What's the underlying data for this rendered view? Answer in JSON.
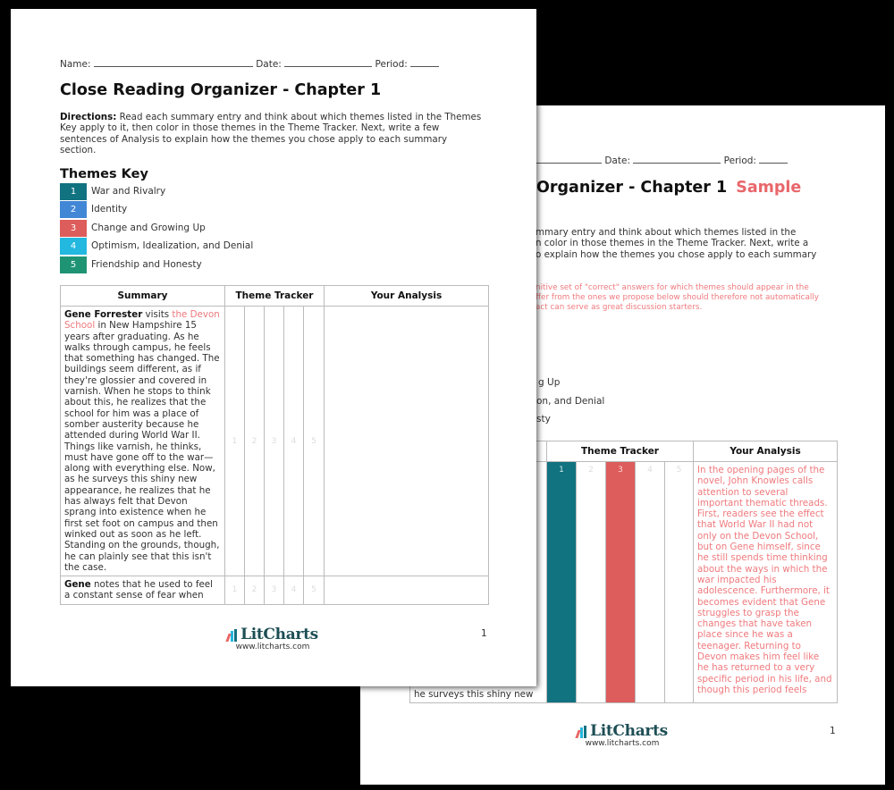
{
  "colors": {
    "theme1": "#117280",
    "theme2": "#4287d6",
    "theme3": "#dd5c5c",
    "theme4": "#22b8e0",
    "theme5": "#1f9475",
    "accent_red": "#ef7a7e",
    "logo_dark": "#1d4e55"
  },
  "front": {
    "fields": {
      "name": "Name:",
      "date": "Date:",
      "period": "Period:"
    },
    "title": "Close Reading Organizer - Chapter 1",
    "directions_label": "Directions:",
    "directions_text": " Read each summary entry and think about which themes listed in the Themes Key apply to it, then color in those themes in the Theme Tracker. Next, write a few sentences of Analysis to explain how the themes you chose apply to each summary section.",
    "themes_heading": "Themes Key",
    "themes": [
      {
        "num": "1",
        "label": "War and Rivalry"
      },
      {
        "num": "2",
        "label": "Identity"
      },
      {
        "num": "3",
        "label": "Change and Growing Up"
      },
      {
        "num": "4",
        "label": "Optimism, Idealization, and Denial"
      },
      {
        "num": "5",
        "label": "Friendship and Honesty"
      }
    ],
    "table": {
      "headers": {
        "summary": "Summary",
        "tracker": "Theme Tracker",
        "analysis": "Your Analysis"
      },
      "rows": [
        {
          "bold": "Gene Forrester",
          "pre": " visits ",
          "link": "the Devon School",
          "rest": " in New Hampshire 15 years after graduating. As he walks through campus, he feels that something has changed. The buildings seem different, as if they're glossier and covered in varnish. When he stops to think about this, he realizes that the school for him was a place of somber austerity because he attended during World War II. Things like varnish, he thinks, must have gone off to the war—along with everything else. Now, as he surveys this shiny new appearance, he realizes that he has always felt that Devon sprang into existence when he first set foot on campus and then winked out as soon as he left. Standing on the grounds, though, he can plainly see that this isn't the case.",
          "tracker": [
            "1",
            "2",
            "3",
            "4",
            "5"
          ],
          "analysis": ""
        },
        {
          "bold": "Gene",
          "pre": " notes that he used to feel a constant sense of fear when",
          "link": "",
          "rest": "",
          "tracker": [
            "1",
            "2",
            "3",
            "4",
            "5"
          ],
          "analysis": ""
        }
      ]
    },
    "logo": {
      "name": "LitCharts",
      "url": "www.litcharts.com"
    },
    "page_number": "1"
  },
  "back": {
    "fields_visible": {
      "date": "Date:",
      "period": "Period:"
    },
    "title_visible": "Organizer - Chapter 1",
    "sample_label": "Sample",
    "directions_visible": [
      "mmary entry and think about which themes listed in the",
      "n color in those themes in the Theme Tracker. Next, write a",
      "o explain how the themes you chose apply to each summary"
    ],
    "note_visible": [
      "nitive set of \"correct\" answers for which themes should appear in the",
      "ffer from the ones we propose below should therefore not automatically",
      "act can serve as great discussion starters."
    ],
    "themes_visible": [
      "g Up",
      "on, and Denial",
      "sty"
    ],
    "table": {
      "headers": {
        "tracker": "Theme Tracker",
        "analysis": "Your Analysis"
      },
      "tracker": [
        "1",
        "2",
        "3",
        "4",
        "5"
      ],
      "active_themes": [
        "1",
        "3"
      ],
      "summary_fragment": "he surveys this shiny new",
      "analysis": "In the opening pages of the novel, John Knowles calls attention to several important thematic threads. First, readers see the effect that World War II had not only on the Devon School, but on Gene himself, since he still spends time thinking about the ways in which the war impacted his adolescence. Furthermore, it becomes evident that Gene struggles to grasp the changes that have taken place since he was a teenager. Returning to Devon makes him feel like he has returned to a very specific period in his life, and though this period feels"
    },
    "logo": {
      "name": "LitCharts",
      "url": "www.litcharts.com"
    },
    "page_number": "1"
  }
}
